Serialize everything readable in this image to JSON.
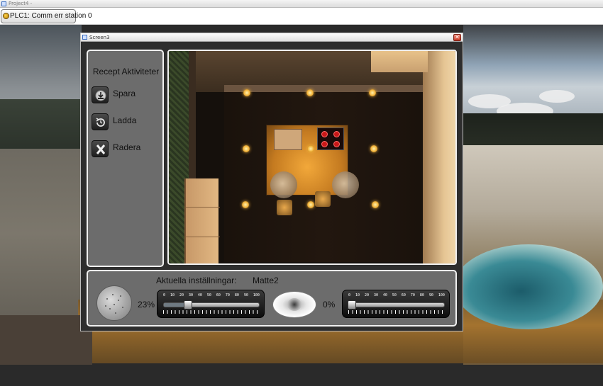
{
  "app": {
    "title": "Project4 -"
  },
  "status_bar": {
    "plc_button_label": "PLC1: Comm err station 0"
  },
  "window": {
    "title": "Screen3",
    "close_icon": "close-icon"
  },
  "recipe_panel": {
    "heading": "Recept Aktiviteter",
    "buttons": [
      {
        "label": "Spara",
        "icon": "save-icon"
      },
      {
        "label": "Ladda",
        "icon": "load-icon"
      },
      {
        "label": "Radera",
        "icon": "delete-icon"
      }
    ]
  },
  "settings": {
    "label": "Aktuella inställningar:",
    "value": "Matte2",
    "slider_ticks": [
      "0",
      "10",
      "20",
      "30",
      "40",
      "50",
      "60",
      "70",
      "80",
      "90",
      "100"
    ],
    "slider1": {
      "percent_text": "23%",
      "value": 23
    },
    "slider2": {
      "percent_text": "0%",
      "value": 0
    },
    "dimmer_icon": "speckle-dimmer-icon",
    "lamp_icon": "lamp-icon"
  },
  "colors": {
    "panel": "#6c6c6c",
    "close_red": "#c83a26",
    "island_light": "#f2a83a"
  }
}
